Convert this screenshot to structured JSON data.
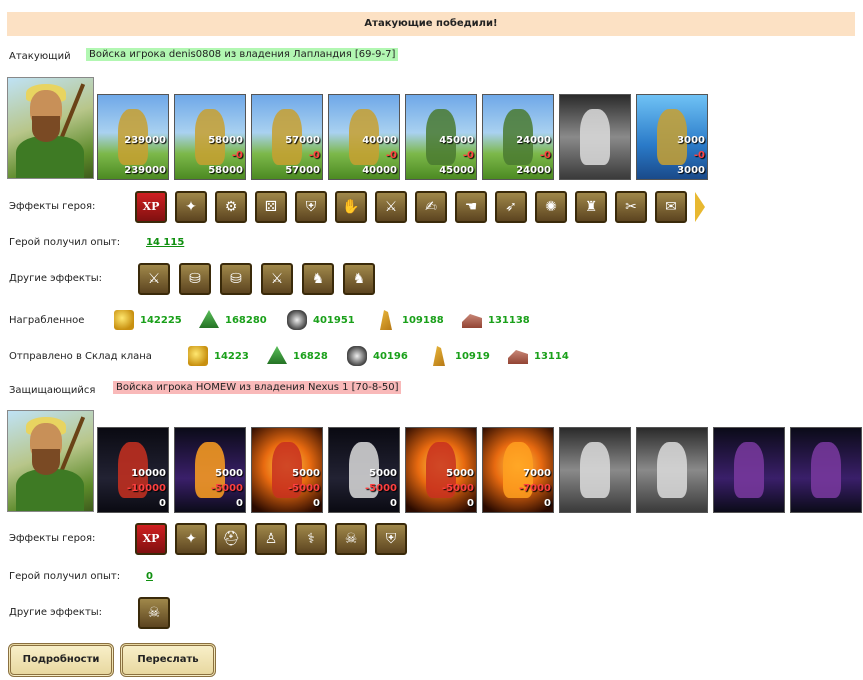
{
  "banner": "Атакующие победили!",
  "attacker": {
    "label": "Атакующий",
    "army": "Войска игрока denis0808 из владения Лапландия [69-9-7]",
    "units": [
      {
        "top": "239000",
        "mid": "",
        "bot": "239000",
        "style": "sky",
        "fig": "gold"
      },
      {
        "top": "58000",
        "mid": "-0",
        "bot": "58000",
        "style": "sky",
        "fig": "gold"
      },
      {
        "top": "57000",
        "mid": "-0",
        "bot": "57000",
        "style": "sky",
        "fig": "gold"
      },
      {
        "top": "40000",
        "mid": "-0",
        "bot": "40000",
        "style": "sky",
        "fig": "gold"
      },
      {
        "top": "45000",
        "mid": "-0",
        "bot": "45000",
        "style": "sky",
        "fig": "green"
      },
      {
        "top": "24000",
        "mid": "-0",
        "bot": "24000",
        "style": "sky",
        "fig": "green"
      },
      {
        "top": "",
        "mid": "",
        "bot": "",
        "style": "gray",
        "fig": "gray"
      },
      {
        "top": "3000",
        "mid": "-0",
        "bot": "3000",
        "style": "blue",
        "fig": "gold"
      }
    ],
    "hero_effects_label": "Эффекты героя:",
    "hero_effects": [
      {
        "name": "xp-icon",
        "glyph": "XP"
      },
      {
        "name": "hero-xp-icon",
        "glyph": "✦"
      },
      {
        "name": "wheel-icon",
        "glyph": "⚙"
      },
      {
        "name": "dice-icon",
        "glyph": "⚄"
      },
      {
        "name": "shield-icon",
        "glyph": "⛨"
      },
      {
        "name": "shield-hand-icon",
        "glyph": "✋"
      },
      {
        "name": "sword-icon",
        "glyph": "⚔"
      },
      {
        "name": "handshake-icon",
        "glyph": "✍"
      },
      {
        "name": "hand-icon",
        "glyph": "☚"
      },
      {
        "name": "boot-icon",
        "glyph": "➶"
      },
      {
        "name": "web-icon",
        "glyph": "✺"
      },
      {
        "name": "armor-icon",
        "glyph": "♜"
      },
      {
        "name": "crossed-swords-icon",
        "glyph": "✂"
      },
      {
        "name": "scroll-icon",
        "glyph": "✉"
      }
    ],
    "xp_label": "Герой получил опыт:",
    "xp_value": "14 115",
    "other_effects_label": "Другие эффекты:",
    "other_effects": [
      {
        "name": "sword-icon",
        "glyph": "⚔"
      },
      {
        "name": "coins-icon",
        "glyph": "⛁"
      },
      {
        "name": "coins-icon-2",
        "glyph": "⛁"
      },
      {
        "name": "sword-icon-2",
        "glyph": "⚔"
      },
      {
        "name": "horse-icon",
        "glyph": "♞"
      },
      {
        "name": "horse-icon-2",
        "glyph": "♞"
      }
    ],
    "loot_label": "Награбленное",
    "loot": [
      "142225",
      "168280",
      "401951",
      "109188",
      "131138"
    ],
    "clan_label": "Отправлено в Склад клана",
    "clan": [
      "14223",
      "16828",
      "40196",
      "10919",
      "13114"
    ]
  },
  "defender": {
    "label": "Защищающийся",
    "army": "Войска игрока HOMEW из владения Nexus 1 [70-8-50]",
    "units": [
      {
        "top": "10000",
        "mid": "-10000",
        "bot": "0",
        "style": "dark",
        "fig": "red"
      },
      {
        "top": "5000",
        "mid": "-5000",
        "bot": "0",
        "style": "purple",
        "fig": "orange"
      },
      {
        "top": "5000",
        "mid": "-5000",
        "bot": "0",
        "style": "fire",
        "fig": "red"
      },
      {
        "top": "5000",
        "mid": "-5000",
        "bot": "0",
        "style": "dark",
        "fig": "gray"
      },
      {
        "top": "5000",
        "mid": "-5000",
        "bot": "0",
        "style": "fire",
        "fig": "red"
      },
      {
        "top": "7000",
        "mid": "-7000",
        "bot": "0",
        "style": "fire",
        "fig": "orange"
      },
      {
        "top": "",
        "mid": "",
        "bot": "",
        "style": "gray",
        "fig": "gray"
      },
      {
        "top": "",
        "mid": "",
        "bot": "",
        "style": "gray",
        "fig": "gray"
      },
      {
        "top": "",
        "mid": "",
        "bot": "",
        "style": "purple",
        "fig": "violet"
      },
      {
        "top": "",
        "mid": "",
        "bot": "",
        "style": "purple",
        "fig": "violet"
      }
    ],
    "hero_effects_label": "Эффекты героя:",
    "hero_effects": [
      {
        "name": "xp-icon",
        "glyph": "XP"
      },
      {
        "name": "hero-xp-icon",
        "glyph": "✦"
      },
      {
        "name": "helmet-icon",
        "glyph": "⛑"
      },
      {
        "name": "robe-icon",
        "glyph": "♙"
      },
      {
        "name": "staff-icon",
        "glyph": "⚕"
      },
      {
        "name": "skeleton-icon",
        "glyph": "☠"
      },
      {
        "name": "gears-shield-icon",
        "glyph": "⛨"
      }
    ],
    "xp_label": "Герой получил опыт:",
    "xp_value": "0",
    "other_effects_label": "Другие эффекты:",
    "other_effects": [
      {
        "name": "skeleton-icon",
        "glyph": "☠"
      }
    ]
  },
  "buttons": {
    "details": "Подробности",
    "forward": "Переслать"
  },
  "colors": {
    "banner_bg": "#fce1c4",
    "attacker_tag": "#b2f7b2",
    "defender_tag": "#f9b9b9",
    "resource_text": "#1aa01a"
  }
}
